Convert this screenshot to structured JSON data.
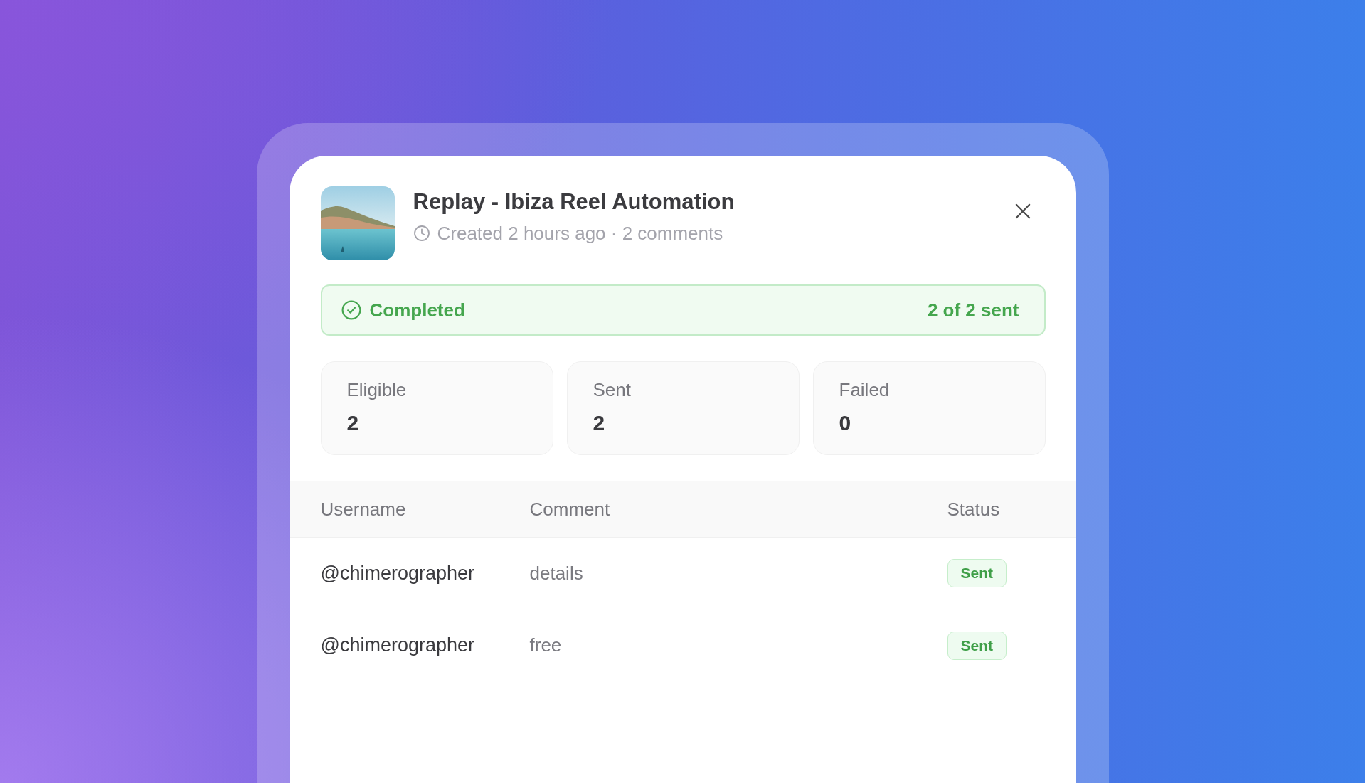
{
  "dialog": {
    "title": "Replay - Ibiza Reel Automation",
    "meta": "Created 2 hours ago · 2 comments"
  },
  "status_banner": {
    "kind": "completed",
    "label": "Completed",
    "progress": "2 of 2 sent"
  },
  "stats": [
    {
      "label": "Eligible",
      "value": "2"
    },
    {
      "label": "Sent",
      "value": "2"
    },
    {
      "label": "Failed",
      "value": "0"
    }
  ],
  "table": {
    "columns": [
      "Username",
      "Comment",
      "Status"
    ],
    "rows": [
      {
        "username": "@chimerographer",
        "comment": "details",
        "status": {
          "kind": "sent",
          "label": "Sent"
        }
      },
      {
        "username": "@chimerographer",
        "comment": "free",
        "status": {
          "kind": "sent",
          "label": "Sent"
        }
      }
    ]
  }
}
